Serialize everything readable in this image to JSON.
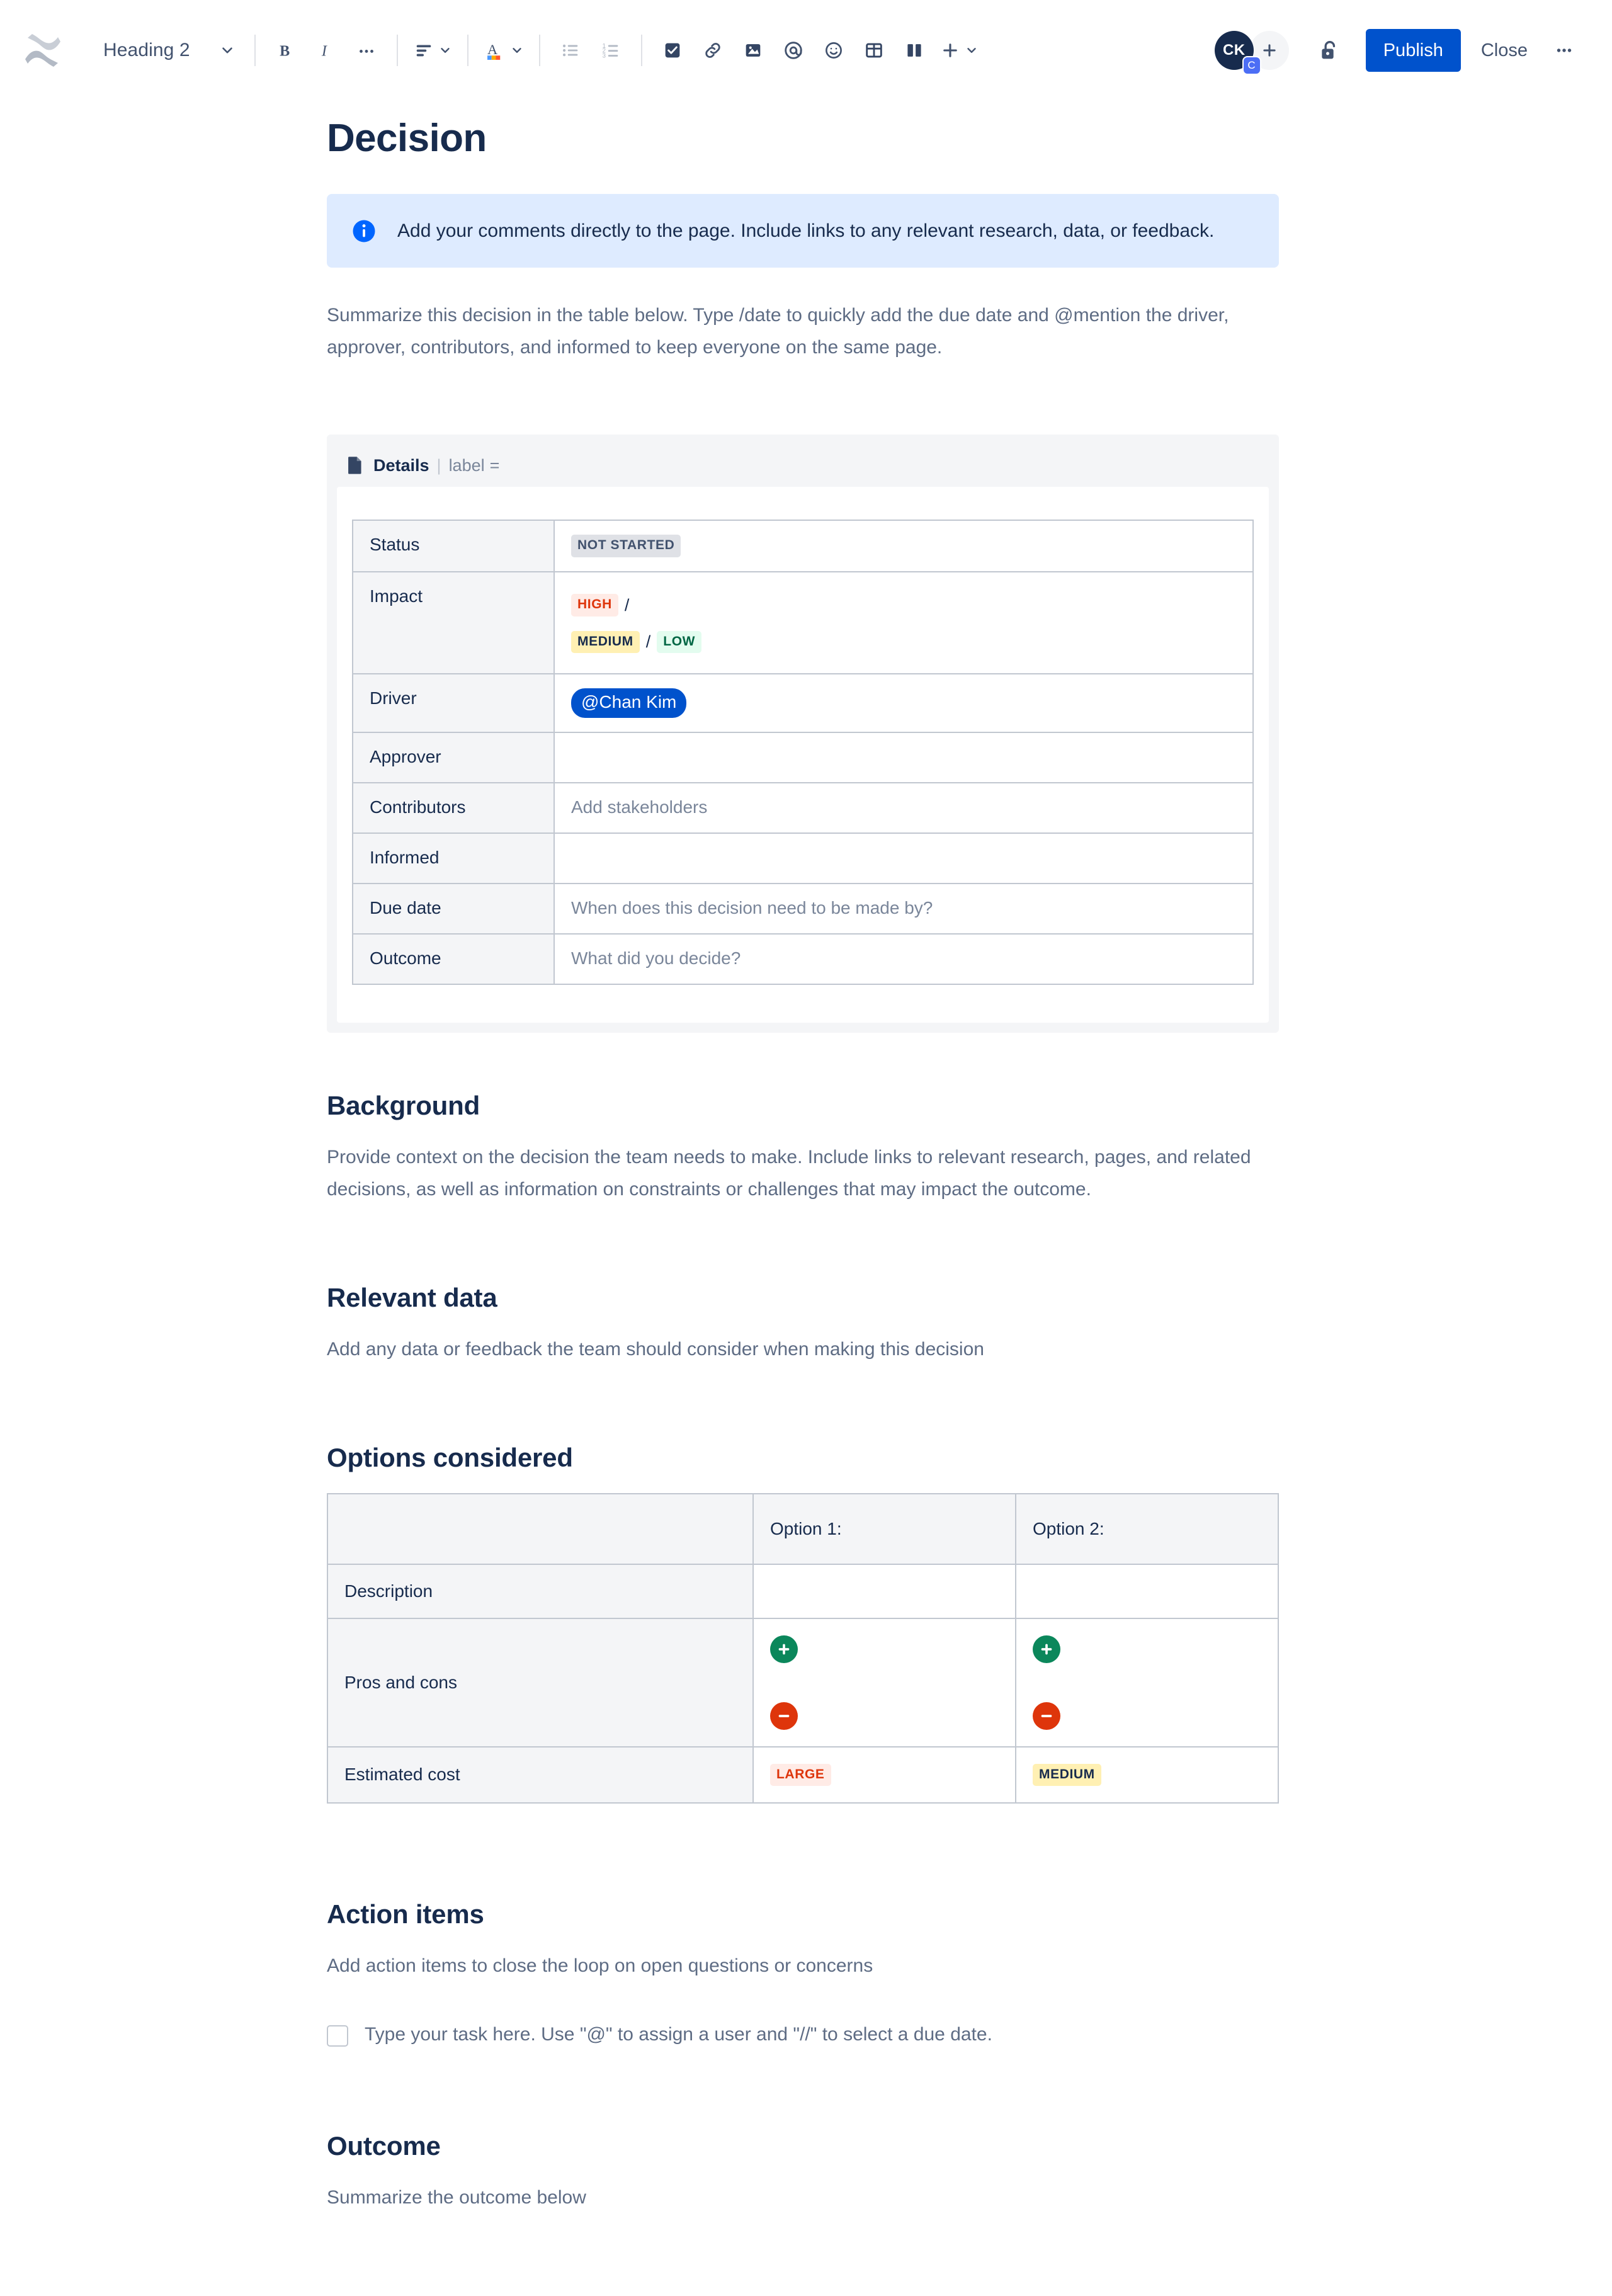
{
  "toolbar": {
    "logo_icon": "confluence-logo-icon",
    "style_picker": {
      "label": "Heading 2",
      "chevron_icon": "chevron-down-icon"
    },
    "buttons": [
      {
        "name": "bold-button",
        "icon": "bold-icon",
        "label": "B"
      },
      {
        "name": "italic-button",
        "icon": "italic-icon",
        "label": "I"
      },
      {
        "name": "more-formatting-button",
        "icon": "ellipsis-icon",
        "label": "..."
      },
      {
        "name": "text-align-button",
        "icon": "text-align-left-icon"
      },
      {
        "name": "text-color-button",
        "icon": "text-color-icon"
      },
      {
        "name": "bullet-list-button",
        "icon": "bullet-list-icon"
      },
      {
        "name": "numbered-list-button",
        "icon": "numbered-list-icon"
      },
      {
        "name": "task-list-button",
        "icon": "checkbox-checked-icon"
      },
      {
        "name": "link-button",
        "icon": "link-icon"
      },
      {
        "name": "image-button",
        "icon": "image-icon"
      },
      {
        "name": "mention-button",
        "icon": "at-mention-icon"
      },
      {
        "name": "emoji-button",
        "icon": "emoji-smiley-icon"
      },
      {
        "name": "table-button",
        "icon": "table-icon"
      },
      {
        "name": "layout-button",
        "icon": "page-layout-icon"
      },
      {
        "name": "insert-more-button",
        "icon": "plus-icon"
      }
    ],
    "avatar": {
      "initials": "CK",
      "badge": "C"
    },
    "add_collaborator_icon": "plus-icon",
    "restrictions_icon": "unlock-icon",
    "publish_label": "Publish",
    "close_label": "Close",
    "more_actions_icon": "ellipsis-icon"
  },
  "document": {
    "title": "Decision",
    "info_panel": {
      "icon": "info-icon",
      "text": "Add your comments directly to the page. Include links to any relevant research, data, or feedback."
    },
    "intro_paragraph": "Summarize this decision in the table below. Type /date to quickly add the due date and @mention the driver, approver, contributors, and informed to keep everyone on the same page.",
    "details_macro": {
      "icon": "page-details-icon",
      "title": "Details",
      "divider": "|",
      "param_label": "label",
      "param_equals": "=",
      "rows": [
        {
          "label": "Status",
          "value_type": "lozenges",
          "lozenges": [
            {
              "text": "NOT STARTED",
              "style": "default"
            }
          ]
        },
        {
          "label": "Impact",
          "value_type": "lozenge_lines",
          "lines": [
            [
              {
                "text": "HIGH",
                "style": "removed"
              },
              {
                "text": "/",
                "style": "sep"
              }
            ],
            [
              {
                "text": "MEDIUM",
                "style": "moved"
              },
              {
                "text": "/",
                "style": "sep"
              },
              {
                "text": "LOW",
                "style": "success"
              }
            ]
          ]
        },
        {
          "label": "Driver",
          "value_type": "mention",
          "mention": "@Chan Kim"
        },
        {
          "label": "Approver",
          "value_type": "empty",
          "value": ""
        },
        {
          "label": "Contributors",
          "value_type": "placeholder",
          "value": "Add stakeholders"
        },
        {
          "label": "Informed",
          "value_type": "empty",
          "value": ""
        },
        {
          "label": "Due date",
          "value_type": "placeholder",
          "value": "When does this decision need to be made by?"
        },
        {
          "label": "Outcome",
          "value_type": "placeholder",
          "value": "What did you decide?"
        }
      ]
    },
    "sections": {
      "background": {
        "heading": "Background",
        "body": "Provide context on the decision the team needs to make. Include links to relevant research, pages, and related decisions, as well as information on constraints or challenges that may impact the outcome."
      },
      "relevant_data": {
        "heading": "Relevant data",
        "body": "Add any data or feedback the team should consider when making this decision"
      },
      "options_considered": {
        "heading": "Options considered",
        "table": {
          "columns": [
            "",
            "Option 1:",
            "Option 2:"
          ],
          "rows": [
            {
              "label": "Description",
              "option1": "",
              "option2": ""
            },
            {
              "label": "Pros and cons",
              "option1_icons": [
                "plus-circle-icon",
                "minus-circle-icon"
              ],
              "option2_icons": [
                "plus-circle-icon",
                "minus-circle-icon"
              ]
            },
            {
              "label": "Estimated cost",
              "option1_lozenge": {
                "text": "LARGE",
                "style": "removed"
              },
              "option2_lozenge": {
                "text": "MEDIUM",
                "style": "moved"
              }
            }
          ]
        }
      },
      "action_items": {
        "heading": "Action items",
        "body": "Add action items to close the loop on open questions or concerns",
        "task_placeholder": "Type your task here. Use \"@\" to assign a user and \"//\" to select a due date."
      },
      "outcome": {
        "heading": "Outcome",
        "body": "Summarize the outcome below"
      }
    }
  },
  "colors": {
    "brand_blue": "#0052cc",
    "text_primary": "#172b4d",
    "text_subtle": "#5e6c84",
    "info_panel_bg": "#deebff",
    "surface_neutral": "#f4f5f7",
    "border": "#c1c7d0",
    "lozenge_removed_bg": "#ffebe6",
    "lozenge_removed_fg": "#de350b",
    "lozenge_moved_bg": "#fff0b3",
    "lozenge_success_bg": "#e3fcef",
    "lozenge_success_fg": "#006644",
    "emoji_green": "#0b875b",
    "emoji_red": "#de350b"
  }
}
